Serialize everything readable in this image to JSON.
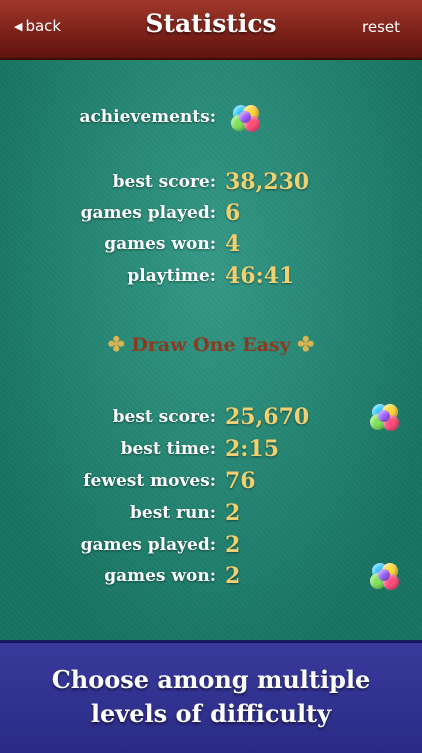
{
  "header": {
    "back_label": "back",
    "title": "Statistics",
    "reset_label": "reset"
  },
  "overall": {
    "achievements_label": "achievements:",
    "best_score_label": "best score:",
    "best_score": "38,230",
    "games_played_label": "games played:",
    "games_played": "6",
    "games_won_label": "games won:",
    "games_won": "4",
    "playtime_label": "playtime:",
    "playtime": "46:41"
  },
  "section": {
    "title": "Draw One Easy",
    "ornament": "✤",
    "best_score_label": "best score:",
    "best_score": "25,670",
    "best_time_label": "best time:",
    "best_time": "2:15",
    "fewest_moves_label": "fewest moves:",
    "fewest_moves": "76",
    "best_run_label": "best run:",
    "best_run": "2",
    "games_played_label": "games played:",
    "games_played": "2",
    "games_won_label": "games won:",
    "games_won": "2"
  },
  "banner": {
    "line1": "Choose among multiple",
    "line2": "levels of difficulty"
  },
  "icons": {
    "achievement": "game-center-icon"
  },
  "colors": {
    "header": "#7a2018",
    "felt": "#1d8d78",
    "value": "#f0d070",
    "section_title": "#8a3a20",
    "banner": "#2e2e8c"
  }
}
